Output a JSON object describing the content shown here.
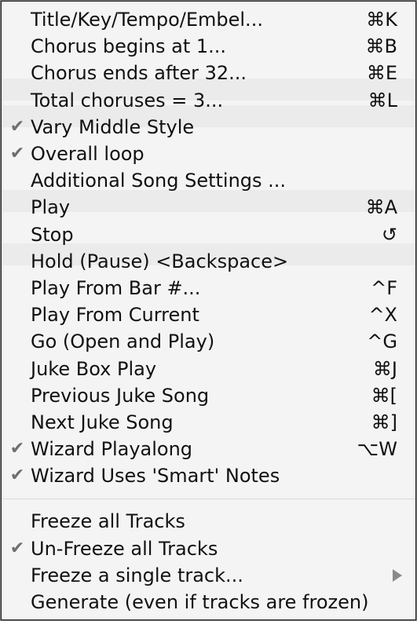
{
  "menu": {
    "items": [
      {
        "label": "Title/Key/Tempo/Embel...",
        "shortcut": "⌘K",
        "checked": false,
        "submenu": false
      },
      {
        "label": "Chorus begins at  1...",
        "shortcut": "⌘B",
        "checked": false,
        "submenu": false
      },
      {
        "label": "Chorus ends after  32...",
        "shortcut": "⌘E",
        "checked": false,
        "submenu": false
      },
      {
        "label": "Total choruses =  3...",
        "shortcut": "⌘L",
        "checked": false,
        "submenu": false
      },
      {
        "label": "Vary Middle Style",
        "shortcut": "",
        "checked": true,
        "submenu": false
      },
      {
        "label": "Overall loop",
        "shortcut": "",
        "checked": true,
        "submenu": false
      },
      {
        "label": "Additional Song Settings ...",
        "shortcut": "",
        "checked": false,
        "submenu": false
      },
      {
        "label": "Play",
        "shortcut": "⌘A",
        "checked": false,
        "submenu": false
      },
      {
        "label": "Stop",
        "shortcut": "↺",
        "checked": false,
        "submenu": false
      },
      {
        "label": "Hold (Pause)  <Backspace>",
        "shortcut": "",
        "checked": false,
        "submenu": false
      },
      {
        "label": "Play From Bar #...",
        "shortcut": "^F",
        "checked": false,
        "submenu": false
      },
      {
        "label": "Play From Current",
        "shortcut": "^X",
        "checked": false,
        "submenu": false
      },
      {
        "label": "Go (Open and Play)",
        "shortcut": "^G",
        "checked": false,
        "submenu": false
      },
      {
        "label": "Juke Box Play",
        "shortcut": "⌘J",
        "checked": false,
        "submenu": false
      },
      {
        "label": "Previous Juke Song",
        "shortcut": "⌘[",
        "checked": false,
        "submenu": false
      },
      {
        "label": "Next Juke Song",
        "shortcut": "⌘]",
        "checked": false,
        "submenu": false
      },
      {
        "label": "Wizard Playalong",
        "shortcut": "⌥W",
        "checked": true,
        "submenu": false
      },
      {
        "label": "Wizard Uses 'Smart' Notes",
        "shortcut": "",
        "checked": true,
        "submenu": false
      }
    ],
    "items2": [
      {
        "label": "Freeze all Tracks",
        "shortcut": "",
        "checked": false,
        "submenu": false
      },
      {
        "label": "Un-Freeze all Tracks",
        "shortcut": "",
        "checked": true,
        "submenu": false
      },
      {
        "label": "Freeze a single track...",
        "shortcut": "",
        "checked": false,
        "submenu": true
      },
      {
        "label": "Generate (even if tracks are frozen)",
        "shortcut": "",
        "checked": false,
        "submenu": false
      }
    ],
    "check_glyph": "✔"
  }
}
